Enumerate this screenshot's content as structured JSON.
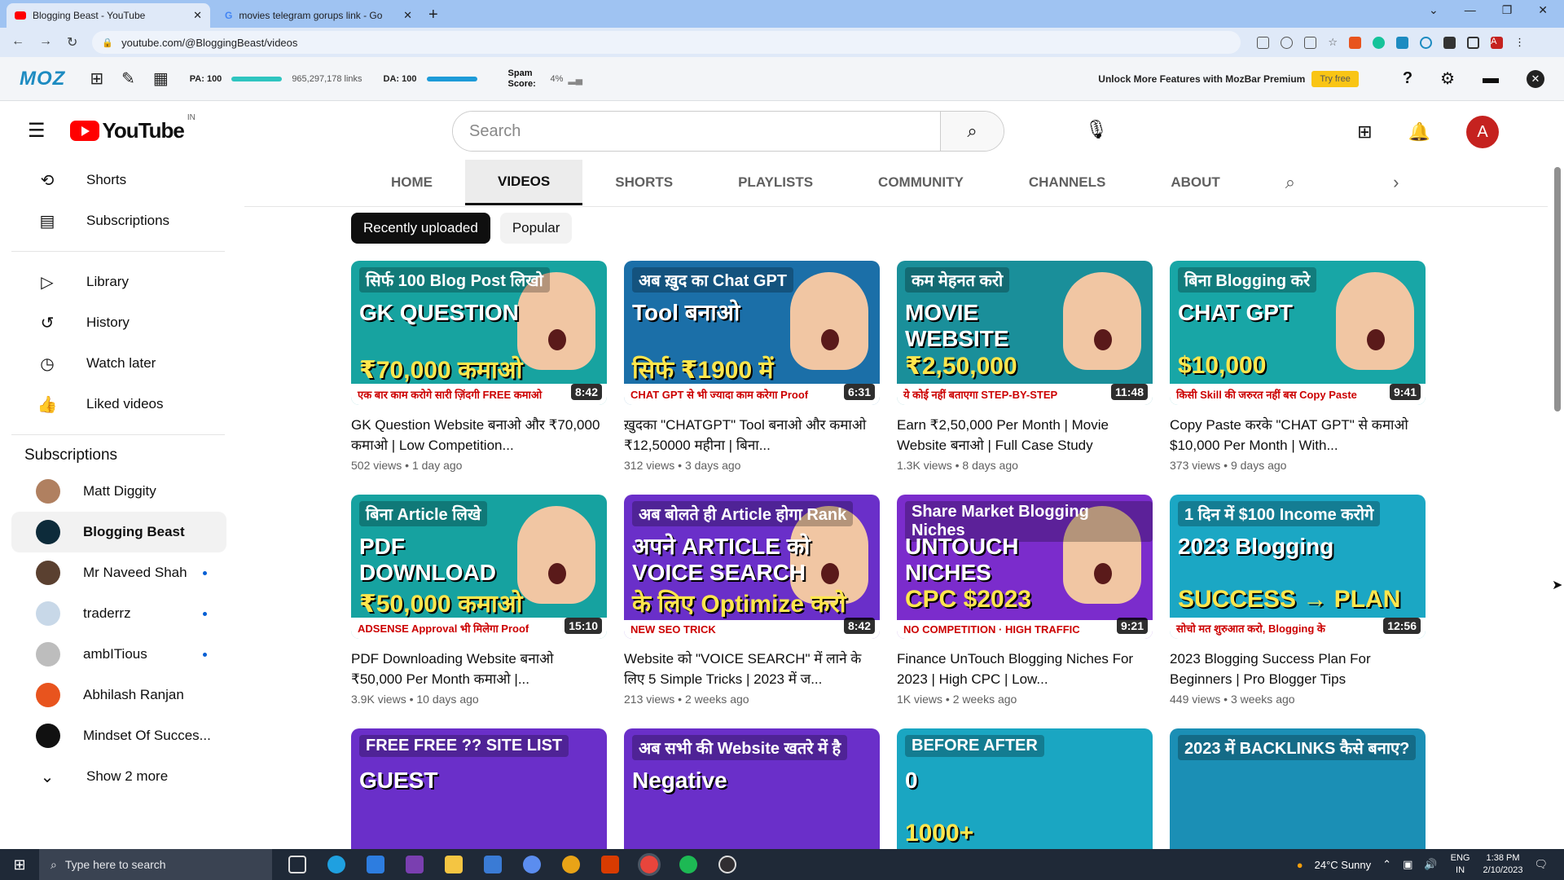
{
  "browser": {
    "tabs": [
      {
        "title": "Blogging Beast - YouTube",
        "close": "✕"
      },
      {
        "title": "movies telegram gorups link - Go",
        "close": "✕"
      }
    ],
    "new_tab": "+",
    "url": "youtube.com/@BloggingBeast/videos"
  },
  "mozbar": {
    "logo": "MOZ",
    "pa_label": "PA: 100",
    "links": "965,297,178 links",
    "da_label": "DA: 100",
    "spam_label": "Spam Score:",
    "spam_value": "4%",
    "unlock_text": "Unlock More Features with MozBar Premium",
    "try_free": "Try free",
    "help": "?",
    "pa_level": 1.0,
    "da_level": 1.0
  },
  "youtube": {
    "logo_text": "YouTube",
    "country": "IN",
    "search_placeholder": "Search",
    "avatar": "A",
    "sidebar": {
      "items": [
        {
          "label": "Shorts",
          "icon": "shorts-icon",
          "glyph": "⟲"
        },
        {
          "label": "Subscriptions",
          "icon": "subscriptions-icon",
          "glyph": "▤"
        }
      ],
      "items2": [
        {
          "label": "Library",
          "icon": "library-icon",
          "glyph": "▷"
        },
        {
          "label": "History",
          "icon": "history-icon",
          "glyph": "↺"
        },
        {
          "label": "Watch later",
          "icon": "clock-icon",
          "glyph": "◷"
        },
        {
          "label": "Liked videos",
          "icon": "thumbs-up-icon",
          "glyph": "👍"
        }
      ],
      "subscriptions_heading": "Subscriptions",
      "channels": [
        {
          "name": "Matt Diggity",
          "color": "#b08060",
          "dot": false,
          "active": false
        },
        {
          "name": "Blogging Beast",
          "color": "#0d2b3a",
          "dot": false,
          "active": true
        },
        {
          "name": "Mr Naveed Shah",
          "color": "#5a4030",
          "dot": true,
          "active": false
        },
        {
          "name": "traderrz",
          "color": "#c8d8e8",
          "dot": true,
          "active": false
        },
        {
          "name": "ambITious",
          "color": "#bdbdbd",
          "dot": true,
          "active": false
        },
        {
          "name": "Abhilash Ranjan",
          "color": "#e8541e",
          "dot": false,
          "active": false
        },
        {
          "name": "Mindset Of Succes...",
          "color": "#111111",
          "dot": false,
          "active": false
        }
      ],
      "show_more": "Show 2 more"
    },
    "channel_tabs": [
      "HOME",
      "VIDEOS",
      "SHORTS",
      "PLAYLISTS",
      "COMMUNITY",
      "CHANNELS",
      "ABOUT"
    ],
    "active_tab": "VIDEOS",
    "chips": [
      "Recently uploaded",
      "Popular"
    ],
    "videos": [
      {
        "title": "GK Question Website बनाओ और ₹70,000 कमाओ | Low Competition...",
        "views": "502 views",
        "age": "1 day ago",
        "duration": "8:42",
        "t1": "सिर्फ 100 Blog Post लिखो",
        "t2": "GK QUESTION",
        "t3": "₹70,000 कमाओ",
        "t4": "एक बार काम करोगे सारी ज़िंदगी FREE कमाओ",
        "bg": "#17a3a0",
        "face": true
      },
      {
        "title": "ख़ुदका \"CHATGPT\" Tool बनाओ और कमाओ ₹12,50000 महीना | बिना...",
        "views": "312 views",
        "age": "3 days ago",
        "duration": "6:31",
        "t1": "अब ख़ुद का Chat GPT",
        "t2": "Tool बनाओ",
        "t3": "सिर्फ ₹1900 में",
        "t4": "CHAT GPT से भी ज्यादा काम करेगा Proof",
        "bg": "#1b6fa8",
        "face": true
      },
      {
        "title": "Earn ₹2,50,000 Per Month | Movie Website बनाओ | Full Case Study",
        "views": "1.3K views",
        "age": "8 days ago",
        "duration": "11:48",
        "t1": "कम मेहनत करो",
        "t2": "MOVIE WEBSITE",
        "t3": "₹2,50,000",
        "t4": "ये कोई नहीं बताएगा STEP-BY-STEP",
        "bg": "#1a8f9a",
        "face": true
      },
      {
        "title": "Copy Paste करके \"CHAT GPT\" से कमाओ $10,000 Per Month | With...",
        "views": "373 views",
        "age": "9 days ago",
        "duration": "9:41",
        "t1": "बिना Blogging करे",
        "t2": "CHAT GPT",
        "t3": "$10,000",
        "t4": "किसी Skill की जरुरत नहीं बस Copy Paste",
        "bg": "#18a6a6",
        "face": true
      },
      {
        "title": "PDF Downloading Website बनाओ ₹50,000 Per Month कमाओ |...",
        "views": "3.9K views",
        "age": "10 days ago",
        "duration": "15:10",
        "t1": "बिना Article लिखे",
        "t2": "PDF DOWNLOAD",
        "t3": "₹50,000 कमाओ",
        "t4": "ADSENSE Approval भी मिलेगा Proof",
        "bg": "#16a2a0",
        "face": true
      },
      {
        "title": "Website को \"VOICE SEARCH\" में लाने के लिए 5 Simple Tricks | 2023 में ज...",
        "views": "213 views",
        "age": "2 weeks ago",
        "duration": "8:42",
        "t1": "अब बोलते ही Article होगा Rank",
        "t2": "अपने ARTICLE को VOICE SEARCH",
        "t3": "के लिए Optimize करो",
        "t4": "NEW SEO TRICK",
        "bg": "#6a2fc9",
        "face": true
      },
      {
        "title": "Finance UnTouch Blogging Niches For 2023 | High CPC | Low...",
        "views": "1K views",
        "age": "2 weeks ago",
        "duration": "9:21",
        "t1": "Share Market Blogging Niches",
        "t2": "UNTOUCH NICHES",
        "t3": "CPC $2023",
        "t4": "NO COMPETITION · HIGH TRAFFIC",
        "bg": "#7b2ccc",
        "face": true
      },
      {
        "title": "2023 Blogging Success Plan For Beginners | Pro Blogger Tips",
        "views": "449 views",
        "age": "3 weeks ago",
        "duration": "12:56",
        "t1": "1 दिन में $100 Income करोगे",
        "t2": "2023 Blogging",
        "t3": "SUCCESS → PLAN",
        "t4": "सोचो मत शुरुआत करो, Blogging के",
        "bg": "#1ba7c4",
        "face": false
      },
      {
        "title": "",
        "views": "",
        "age": "",
        "duration": "",
        "t1": "FREE FREE ?? SITE LIST",
        "t2": "GUEST",
        "t3": "",
        "t4": "",
        "bg": "#6a2fc9",
        "face": false
      },
      {
        "title": "",
        "views": "",
        "age": "",
        "duration": "",
        "t1": "अब सभी की Website खतरे में है",
        "t2": "Negative",
        "t3": "",
        "t4": "",
        "bg": "#6a2fc9",
        "face": false
      },
      {
        "title": "",
        "views": "",
        "age": "",
        "duration": "",
        "t1": "BEFORE  AFTER",
        "t2": "0",
        "t3": "1000+",
        "t4": "",
        "bg": "#1aa6c2",
        "face": false
      },
      {
        "title": "",
        "views": "",
        "age": "",
        "duration": "",
        "t1": "2023 में BACKLINKS कैसे बनाए?",
        "t2": "",
        "t3": "",
        "t4": "",
        "bg": "#1b8fb5",
        "face": false
      }
    ]
  },
  "taskbar": {
    "search_placeholder": "Type here to search",
    "weather": "24°C  Sunny",
    "lang": "ENG IN",
    "time": "1:38 PM",
    "date": "2/10/2023"
  }
}
